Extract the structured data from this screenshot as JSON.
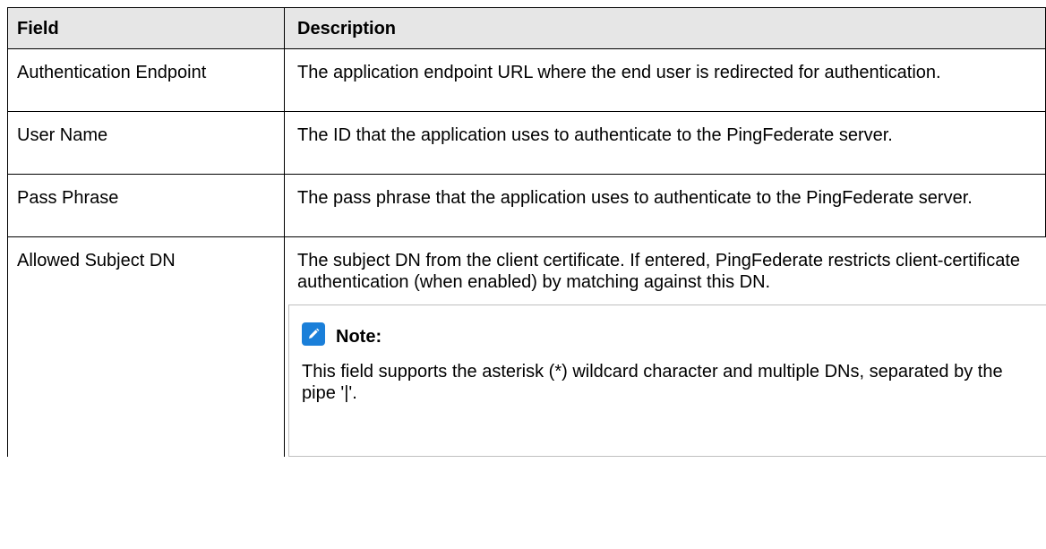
{
  "table": {
    "header": {
      "field": "Field",
      "description": "Description"
    },
    "rows": [
      {
        "field": "Authentication Endpoint",
        "description": "The application endpoint URL where the end user is redirected for authentication."
      },
      {
        "field": "User Name",
        "description": "The ID that the application uses to authenticate to the PingFederate server."
      },
      {
        "field": "Pass Phrase",
        "description": "The pass phrase that the application uses to authenticate to the PingFederate server."
      },
      {
        "field": "Allowed Subject DN",
        "description": "The subject DN from the client certificate. If entered, PingFederate restricts client-certificate authentication (when enabled) by matching against this DN.",
        "note": {
          "icon": "pencil-note-icon",
          "title": "Note:",
          "text": "This field supports the asterisk (*) wildcard character and multiple DNs, separated by the pipe '|'."
        }
      }
    ]
  },
  "colors": {
    "header_bg": "#e6e6e6",
    "note_icon_bg": "#1a7fd9",
    "note_border": "#bfbfbf"
  }
}
